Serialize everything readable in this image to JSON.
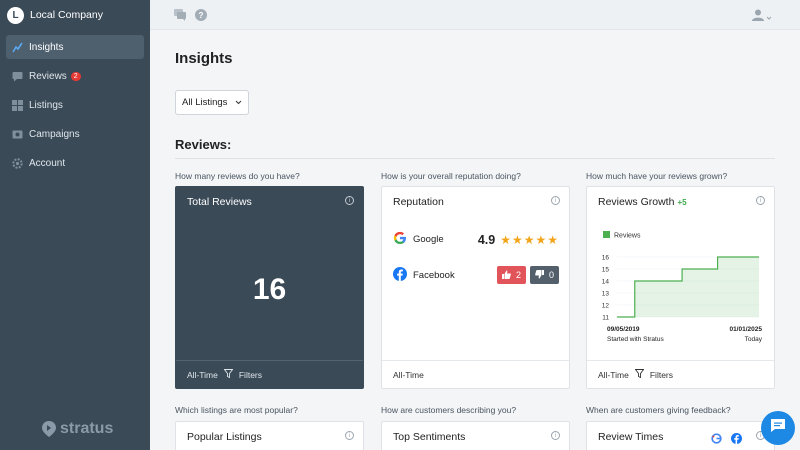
{
  "sidebar": {
    "company_initial": "L",
    "company_name": "Local Company",
    "items": [
      {
        "label": "Insights",
        "icon": "chart-icon",
        "active": true
      },
      {
        "label": "Reviews",
        "icon": "reviews-icon",
        "badge": "2"
      },
      {
        "label": "Listings",
        "icon": "grid-icon"
      },
      {
        "label": "Campaigns",
        "icon": "campaign-icon"
      },
      {
        "label": "Account",
        "icon": "gear-icon"
      }
    ],
    "brand": "stratus"
  },
  "main": {
    "page_title": "Insights",
    "listing_select": "All Listings",
    "reviews_section_title": "Reviews:"
  },
  "questions": {
    "q1": "How many reviews do you have?",
    "q2": "How is your overall reputation doing?",
    "q3": "How much have your reviews grown?",
    "q4": "Which listings are most popular?",
    "q5": "How are customers describing you?",
    "q6": "When are customers giving feedback?"
  },
  "cards": {
    "total_reviews": {
      "title": "Total Reviews",
      "value": "16",
      "footer_range": "All-Time",
      "footer_filter": "Filters"
    },
    "reputation": {
      "title": "Reputation",
      "google_label": "Google",
      "google_rating": "4.9",
      "facebook_label": "Facebook",
      "facebook_up": "2",
      "facebook_down": "0",
      "footer_range": "All-Time"
    },
    "growth": {
      "title": "Reviews Growth",
      "delta": "+5",
      "legend": "Reviews",
      "start_date": "09/05/2019",
      "start_note": "Started with Stratus",
      "end_date": "01/01/2025",
      "end_note": "Today",
      "footer_range": "All-Time",
      "footer_filter": "Filters"
    },
    "popular_listings": {
      "title": "Popular Listings"
    },
    "top_sentiments": {
      "title": "Top Sentiments"
    },
    "review_times": {
      "title": "Review Times"
    }
  },
  "chart_data": {
    "type": "area",
    "legend": [
      "Reviews"
    ],
    "yticks": [
      11,
      12,
      13,
      14,
      15,
      16
    ],
    "ylim": [
      11,
      16
    ],
    "series": [
      {
        "name": "Reviews",
        "values": [
          11,
          11,
          14,
          14,
          14,
          14,
          15,
          15,
          15,
          16,
          16,
          16,
          16
        ]
      }
    ],
    "x_start_label": "09/05/2019",
    "x_end_label": "01/01/2025",
    "color": "#4caf50"
  },
  "colors": {
    "sidebar": "#3b4a57",
    "accent": "#1e88e5",
    "star": "#f2a51a",
    "green": "#4caf50"
  }
}
